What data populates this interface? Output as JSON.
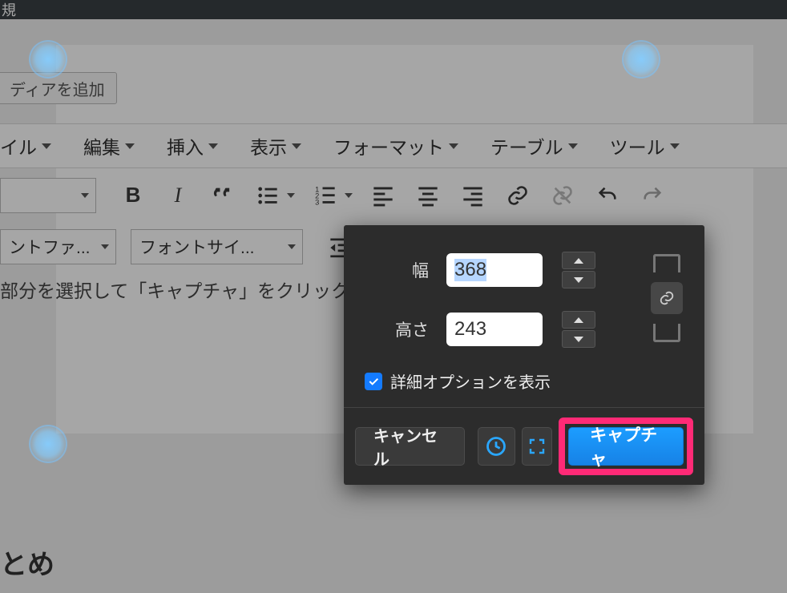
{
  "titlebar": {
    "text": "規"
  },
  "media_button": {
    "label": "ディアを追加"
  },
  "menubar": [
    {
      "label": "イル"
    },
    {
      "label": "編集"
    },
    {
      "label": "挿入"
    },
    {
      "label": "表示"
    },
    {
      "label": "フォーマット"
    },
    {
      "label": "テーブル"
    },
    {
      "label": "ツール"
    }
  ],
  "toolbar": {
    "paragraph_select": "",
    "font_family_select": "ントファ...",
    "font_size_select": "フォントサイ..."
  },
  "editor_text": "部分を選択して「キャプチャ」をクリック",
  "summary_heading": "とめ",
  "capture_dialog": {
    "width_label": "幅",
    "width_value": "368",
    "height_label": "高さ",
    "height_value": "243",
    "advanced_label": "詳細オプションを表示",
    "advanced_checked": true,
    "cancel_label": "キャンセル",
    "capture_label": "キャプチャ"
  }
}
